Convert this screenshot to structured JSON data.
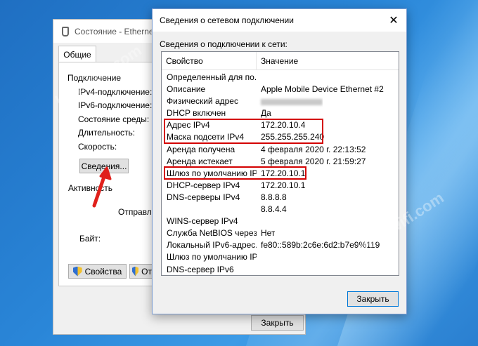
{
  "back_window": {
    "title": "Состояние - Ethernet",
    "tab": "Общие",
    "section_connection": "Подключение",
    "labels": [
      "IPv4-подключение:",
      "IPv6-подключение:",
      "Состояние среды:",
      "Длительность:",
      "Скорость:"
    ],
    "details_button": "Сведения...",
    "section_activity": "Активность",
    "sent_label": "Отправле",
    "bytes_label": "Байт:",
    "properties_button": "Свойства",
    "disable_button_partial": "От",
    "close_button": "Закрыть"
  },
  "dialog": {
    "title": "Сведения о сетевом подключении",
    "caption": "Сведения о подключении к сети:",
    "columns": [
      "Свойство",
      "Значение"
    ],
    "rows": [
      {
        "k": "Определенный для по...",
        "v": ""
      },
      {
        "k": "Описание",
        "v": "Apple Mobile Device Ethernet #2"
      },
      {
        "k": "Физический адрес",
        "v": ""
      },
      {
        "k": "DHCP включен",
        "v": "Да"
      },
      {
        "k": "Адрес IPv4",
        "v": "172.20.10.4"
      },
      {
        "k": "Маска подсети IPv4",
        "v": "255.255.255.240"
      },
      {
        "k": "Аренда получена",
        "v": "4 февраля 2020 г. 22:13:52"
      },
      {
        "k": "Аренда истекает",
        "v": "5 февраля 2020 г. 21:59:27"
      },
      {
        "k": "Шлюз по умолчанию IP...",
        "v": "172.20.10.1"
      },
      {
        "k": "DHCP-сервер IPv4",
        "v": "172.20.10.1"
      },
      {
        "k": "DNS-серверы IPv4",
        "v": "8.8.8.8"
      },
      {
        "k": "",
        "v": "8.8.4.4"
      },
      {
        "k": "WINS-сервер IPv4",
        "v": ""
      },
      {
        "k": "Служба NetBIOS черeз...",
        "v": "Нет"
      },
      {
        "k": "Локальный IPv6-адрес...",
        "v": "fe80::589b:2c6e:6d2:b7e9%119"
      },
      {
        "k": "Шлюз по умолчанию IP...",
        "v": ""
      },
      {
        "k": "DNS-сервер IPv6",
        "v": ""
      }
    ],
    "close_button": "Закрыть"
  },
  "watermark": "help-wifi.com",
  "colors": {
    "highlight": "#d40000",
    "arrow": "#e0201b",
    "desktop": "#2a86d8"
  }
}
